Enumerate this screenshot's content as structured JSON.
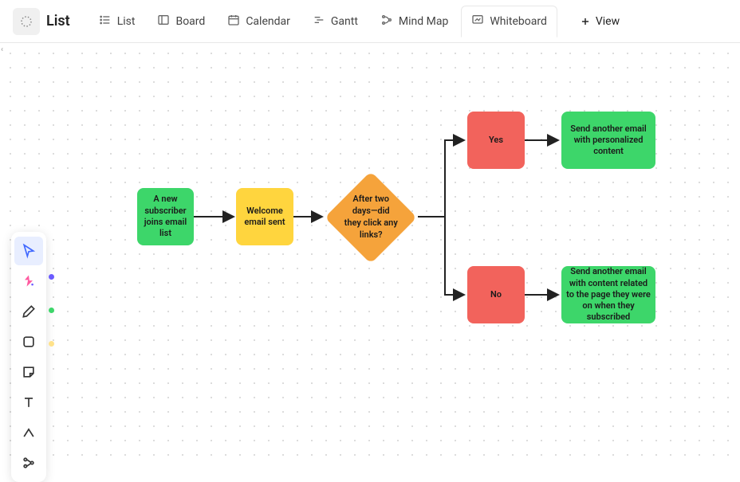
{
  "app": {
    "title": "List"
  },
  "tabs": {
    "list": "List",
    "board": "Board",
    "calendar": "Calendar",
    "gantt": "Gantt",
    "mindmap": "Mind Map",
    "whiteboard": "Whiteboard",
    "add": "View"
  },
  "toolbar": {
    "pointer": "pointer",
    "generate": "generate",
    "pen": "pen",
    "shape": "shape",
    "sticky": "sticky",
    "text": "text",
    "connector": "connector",
    "more": "more"
  },
  "colors": {
    "green": "#3dd66a",
    "yellow": "#ffd53e",
    "orange": "#f5a33b",
    "red": "#f2635c",
    "dot_purple": "#6b5bff",
    "dot_green": "#3dd66a",
    "dot_yellow": "#ffe28a"
  },
  "flow": {
    "start": "A new subscriber joins email list",
    "welcome": "Welcome email sent",
    "decision": "After two days—did they click any links?",
    "yes": "Yes",
    "no": "No",
    "yes_action": "Send another email with personalized content",
    "no_action": "Send another email with content related to the page they were on when they subscribed"
  }
}
